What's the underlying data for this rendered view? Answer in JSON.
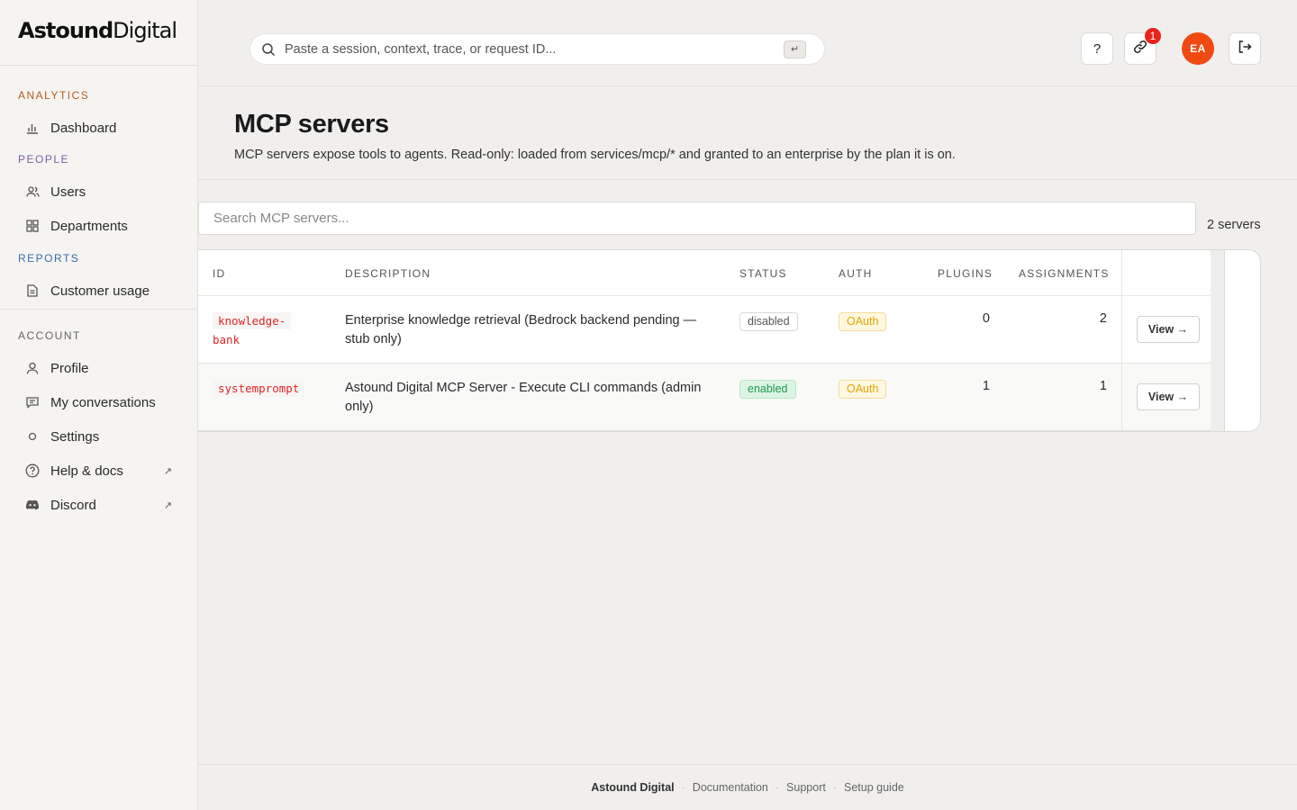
{
  "brand": {
    "logo_bold": "Astound",
    "logo_light": "Digital"
  },
  "sidebar": {
    "sections": [
      {
        "label": "ANALYTICS",
        "color": "#b35c1e",
        "items": [
          {
            "label": "Dashboard",
            "icon": "bar-chart-icon"
          }
        ]
      },
      {
        "label": "PEOPLE",
        "color": "#7b5ea7",
        "items": [
          {
            "label": "Users",
            "icon": "users-icon"
          },
          {
            "label": "Departments",
            "icon": "grid-icon"
          }
        ]
      },
      {
        "label": "REPORTS",
        "color": "#3b6ea8",
        "items": [
          {
            "label": "Customer usage",
            "icon": "document-icon"
          }
        ]
      },
      {
        "label": "ACCOUNT",
        "color": "#666666",
        "items": [
          {
            "label": "Profile",
            "icon": "person-icon"
          },
          {
            "label": "My conversations",
            "icon": "chat-icon"
          },
          {
            "label": "Settings",
            "icon": "circle-icon"
          },
          {
            "label": "Help & docs",
            "icon": "help-circle-icon",
            "external": "↗"
          },
          {
            "label": "Discord",
            "icon": "discord-icon",
            "external": "↗"
          }
        ]
      }
    ]
  },
  "topbar": {
    "search_placeholder": "Paste a session, context, trace, or request ID...",
    "enter_key": "↵",
    "help_label": "?",
    "links_badge": "1",
    "avatar_initials": "EA",
    "avatar_color": "#f04a12"
  },
  "page": {
    "title": "MCP servers",
    "subtitle": "MCP servers expose tools to agents. Read-only: loaded from services/mcp/* and granted to an enterprise by the plan it is on."
  },
  "list": {
    "search_placeholder": "Search MCP servers...",
    "count_label": "2 servers",
    "columns": [
      "ID",
      "DESCRIPTION",
      "STATUS",
      "AUTH",
      "PLUGINS",
      "ASSIGNMENTS"
    ],
    "rows": [
      {
        "id_line1": "knowledge-",
        "id_line2": "bank",
        "description": "Enterprise knowledge retrieval (Bedrock backend pending — stub only)",
        "status": "disabled",
        "auth": "OAuth",
        "plugins": "0",
        "assignments": "2",
        "action": "View →"
      },
      {
        "id_line1": "systemprompt",
        "id_line2": "",
        "description": "Astound Digital MCP Server - Execute CLI commands (admin only)",
        "status": "enabled",
        "auth": "OAuth",
        "plugins": "1",
        "assignments": "1",
        "action": "View →"
      }
    ]
  },
  "footer": {
    "brand": "Astound Digital",
    "links": [
      "Documentation",
      "Support",
      "Setup guide"
    ]
  }
}
